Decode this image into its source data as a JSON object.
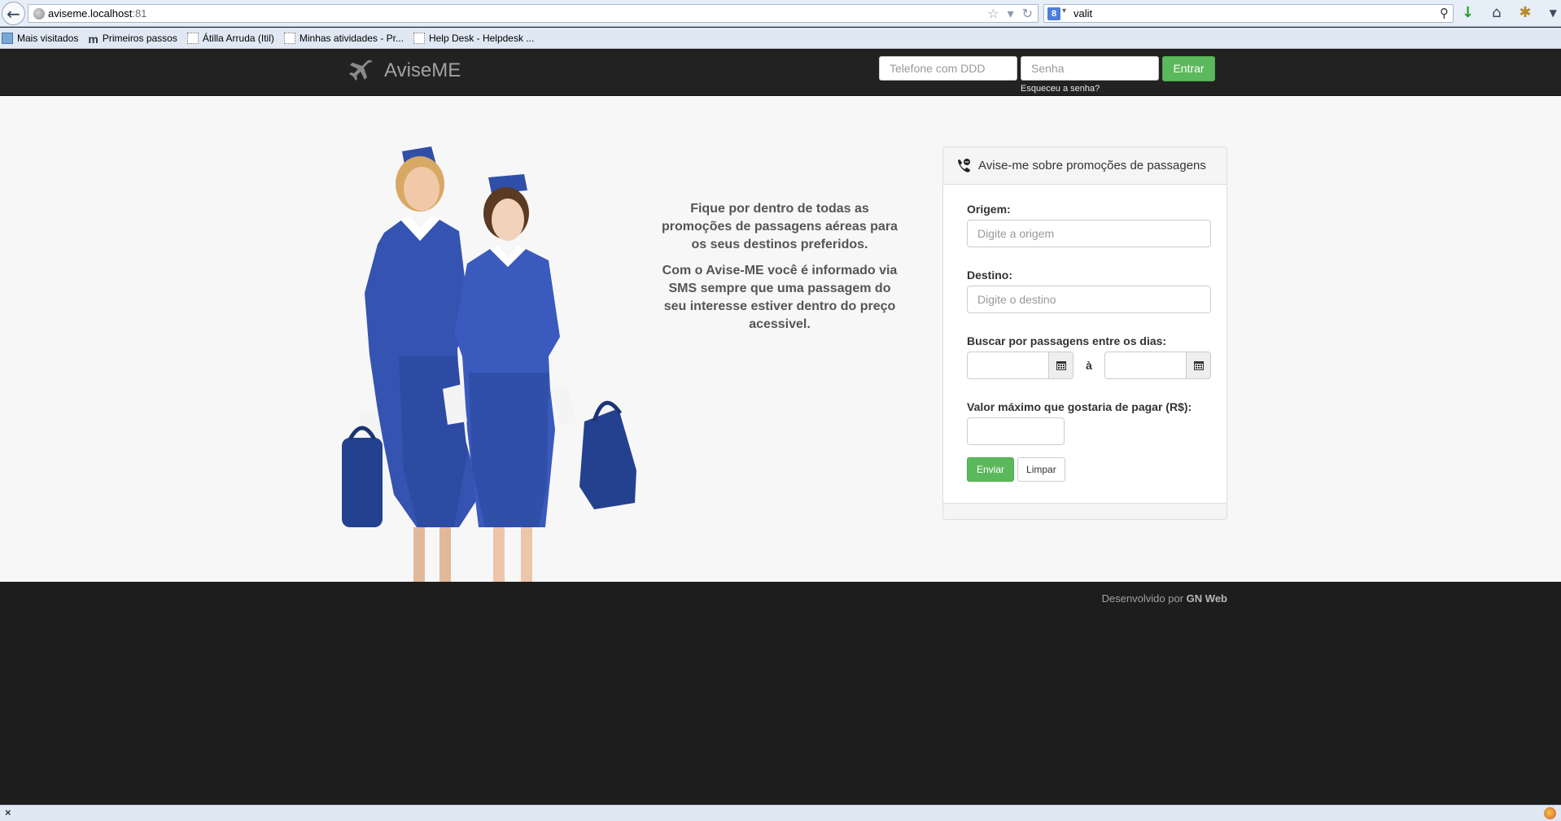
{
  "browser": {
    "url_host": "aviseme.localhost",
    "url_port": ":81",
    "search_query": "valit",
    "search_engine_letter": "8"
  },
  "bookmarks": [
    {
      "label": "Mais visitados",
      "icon": "most-visited-icon"
    },
    {
      "label": "Primeiros passos",
      "icon": "m-logo-icon"
    },
    {
      "label": "Átilla Arruda (Itil)",
      "icon": "page-icon"
    },
    {
      "label": "Minhas atividades - Pr...",
      "icon": "page-icon"
    },
    {
      "label": "Help Desk - Helpdesk ...",
      "icon": "page-icon"
    }
  ],
  "header": {
    "brand": "AviseME",
    "phone_placeholder": "Telefone com DDD",
    "password_placeholder": "Senha",
    "login_label": "Entrar",
    "forgot_label": "Esqueceu a senha?"
  },
  "intro": {
    "paragraph1": "Fique por dentro de todas as promoções de passagens aéreas para os seus destinos preferidos.",
    "paragraph2": "Com o Avise-ME você é informado via SMS sempre que uma passagem do seu interesse estiver dentro do preço acessivel."
  },
  "form": {
    "title": "Avise-me sobre promoções de passagens",
    "origin_label": "Origem:",
    "origin_placeholder": "Digite a origem",
    "destination_label": "Destino:",
    "destination_placeholder": "Digite o destino",
    "dates_label": "Buscar por passagens entre os dias:",
    "dates_separator": "à",
    "max_value_label": "Valor máximo que gostaria de pagar (R$):",
    "send_label": "Enviar",
    "clear_label": "Limpar"
  },
  "footer": {
    "credit_prefix": "Desenvolvido por",
    "credit_name": "GN Web"
  },
  "colors": {
    "accent_green": "#5cb85c",
    "header_bg": "#222222",
    "footer_bg": "#1d1d1d",
    "uniform_blue": "#2f4fa8"
  }
}
